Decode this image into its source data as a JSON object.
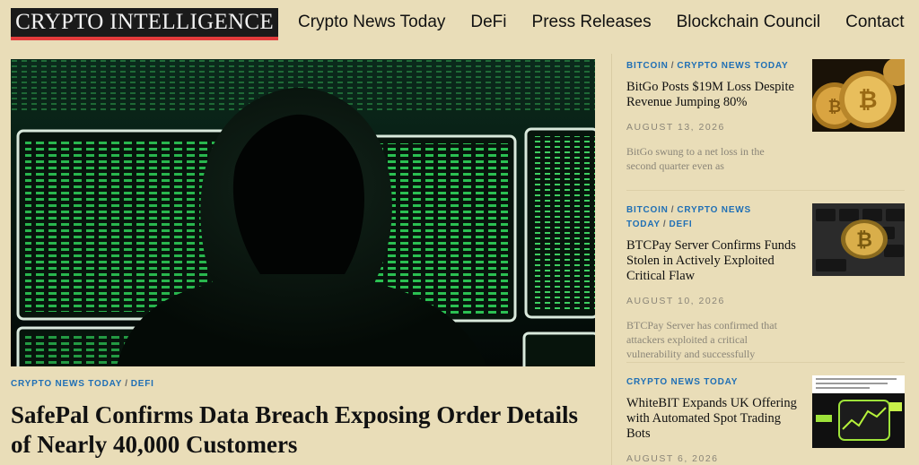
{
  "site": {
    "logo_text": "CRYPTO INTELLIGENCE"
  },
  "nav": [
    "Crypto News Today",
    "DeFi",
    "Press Releases",
    "Blockchain Council",
    "Contact"
  ],
  "hero": {
    "image": "hooded-hacker-at-computer-screens",
    "categories": [
      "CRYPTO NEWS TODAY",
      "DEFI"
    ],
    "separator": "/",
    "title": "SafePal Confirms Data Breach Exposing Order Details of Nearly 40,000 Customers"
  },
  "sidebar": [
    {
      "categories": [
        "BITCOIN",
        "CRYPTO NEWS TODAY"
      ],
      "title": "BitGo Posts $19M Loss Despite Revenue Jumping 80%",
      "date": "AUGUST 13, 2026",
      "excerpt": "BitGo swung to a net loss in the second quarter even as",
      "image": "gold-bitcoin-coins"
    },
    {
      "categories": [
        "BITCOIN",
        "CRYPTO NEWS TODAY",
        "DEFI"
      ],
      "title": "BTCPay Server Confirms Funds Stolen in Actively Exploited Critical Flaw",
      "date": "AUGUST 10, 2026",
      "excerpt": "BTCPay Server has confirmed that attackers exploited a critical vulnerability and successfully",
      "image": "bitcoin-on-keyboard"
    },
    {
      "categories": [
        "CRYPTO NEWS TODAY"
      ],
      "title": "WhiteBIT Expands UK Offering with Automated Spot Trading Bots",
      "date": "AUGUST 6, 2026",
      "excerpt": "",
      "image": "whitebit-trading-bot-screenshot"
    }
  ],
  "colors": {
    "category": "#1f6fb5",
    "background": "#e9ddb8",
    "logo_underline": "#e23b3b"
  }
}
